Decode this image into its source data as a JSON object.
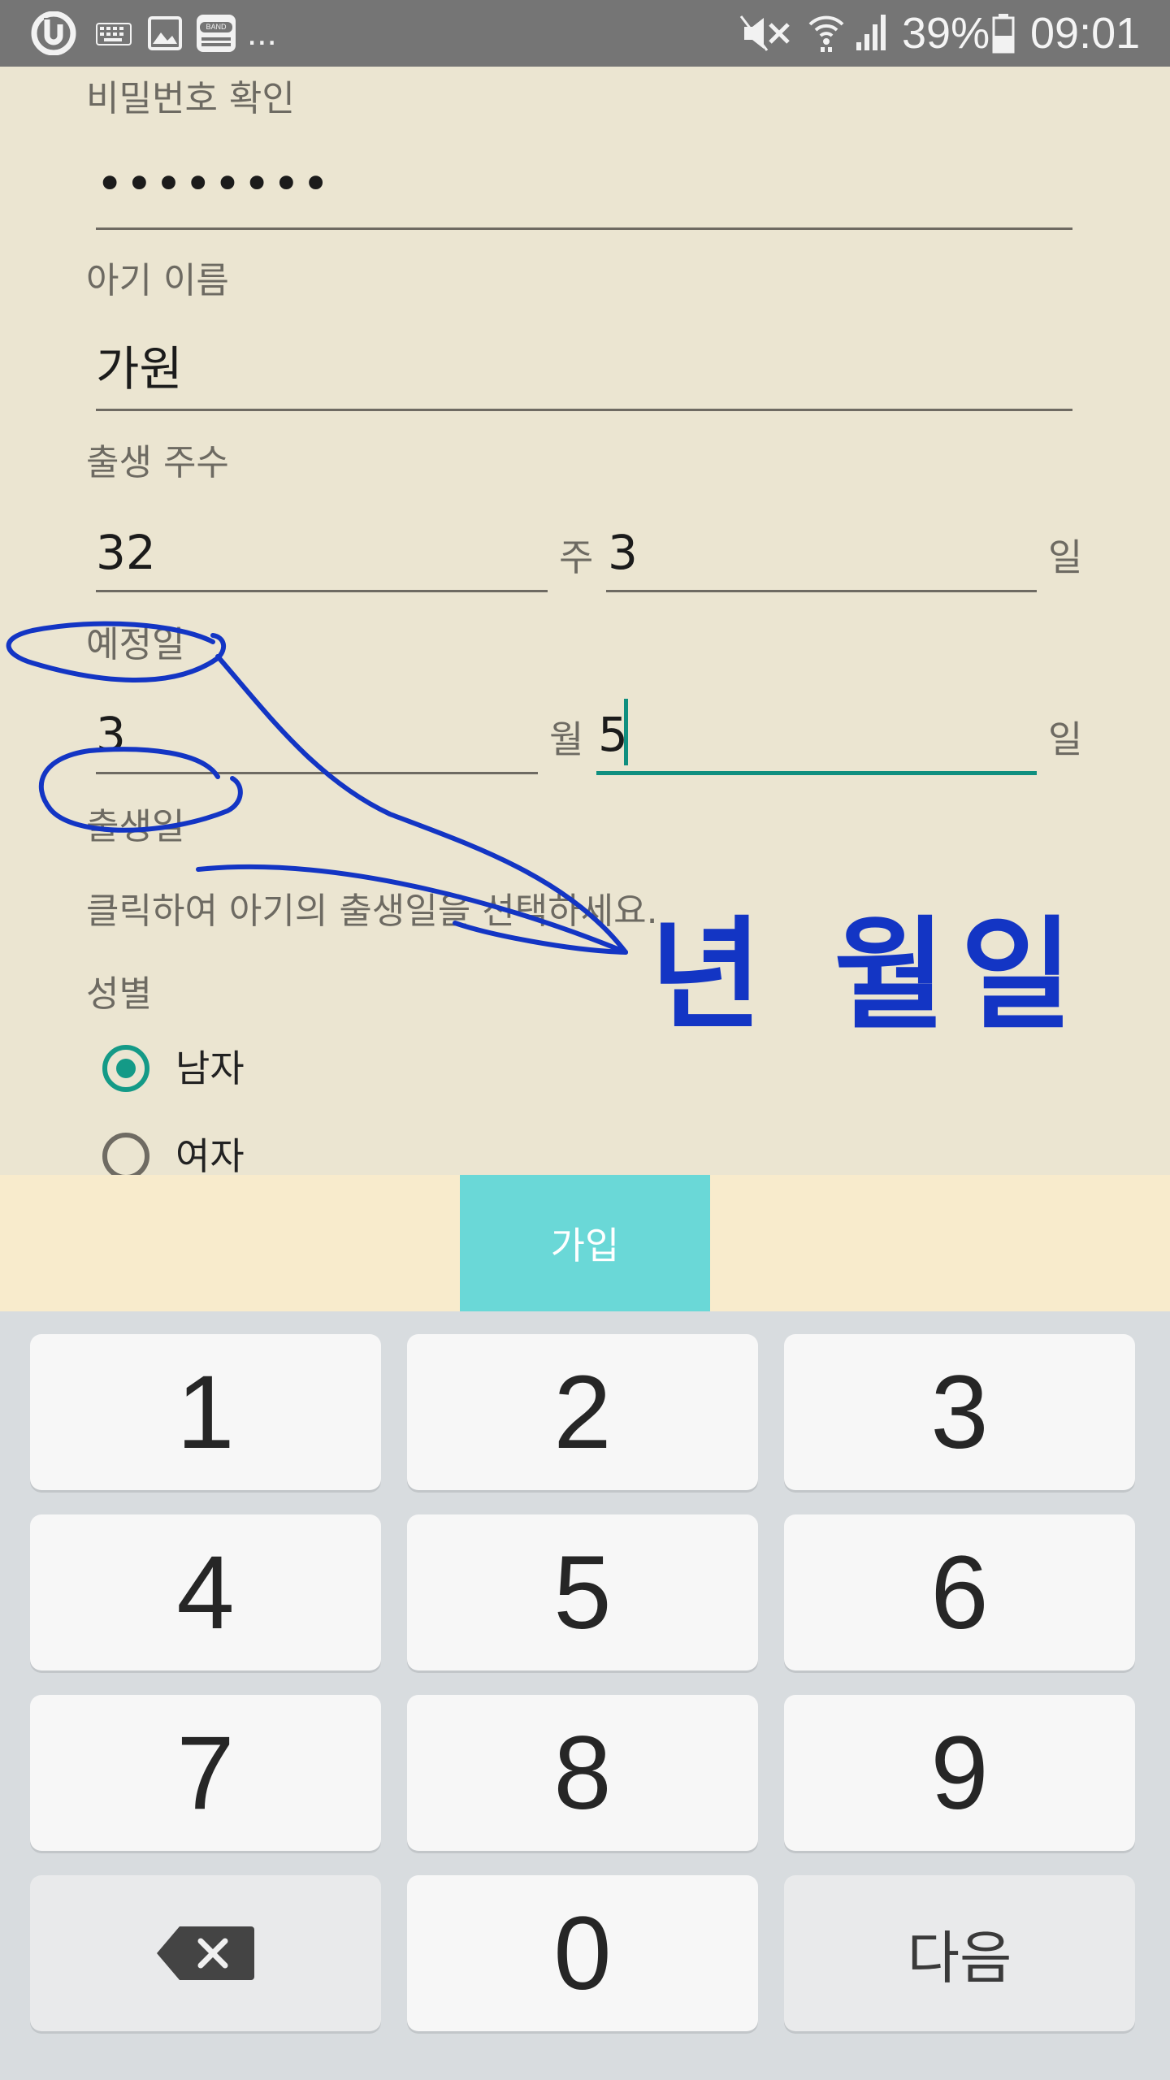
{
  "status_bar": {
    "battery_percent": "39%",
    "time": "09:01",
    "more": "...",
    "band_label": "BAND",
    "icons": [
      "u-logo-icon",
      "keyboard-icon",
      "gallery-icon",
      "band-icon",
      "mute-icon",
      "wifi-icon",
      "signal-icon",
      "battery-icon"
    ]
  },
  "form": {
    "password_confirm": {
      "label": "비밀번호 확인",
      "value": "••••••••"
    },
    "baby_name": {
      "label": "아기 이름",
      "value": "가원"
    },
    "birth_week": {
      "label": "출생 주수",
      "weeks": "32",
      "week_unit": "주",
      "days": "3",
      "day_unit": "일"
    },
    "due_date": {
      "label": "예정일",
      "month": "3",
      "month_unit": "월",
      "day": "5",
      "day_unit": "일"
    },
    "birth_date": {
      "label": "출생일",
      "hint": "클릭하여 아기의 출생일을 선택하세요."
    },
    "gender": {
      "label": "성별",
      "options": [
        {
          "label": "남자",
          "selected": true
        },
        {
          "label": "여자",
          "selected": false
        }
      ]
    }
  },
  "annotation": {
    "handwritten_text": "년 월일",
    "color": "#1335c4"
  },
  "join_button": {
    "label": "가입"
  },
  "keyboard": {
    "keys": [
      "1",
      "2",
      "3",
      "4",
      "5",
      "6",
      "7",
      "8",
      "9",
      "0"
    ],
    "next_label": "다음"
  },
  "colors": {
    "background": "#ebe5d1",
    "accent": "#149a87",
    "join_button": "#6ad8d7",
    "bottom_bar": "#f8ebcc",
    "keyboard": "#d8dcdf"
  }
}
